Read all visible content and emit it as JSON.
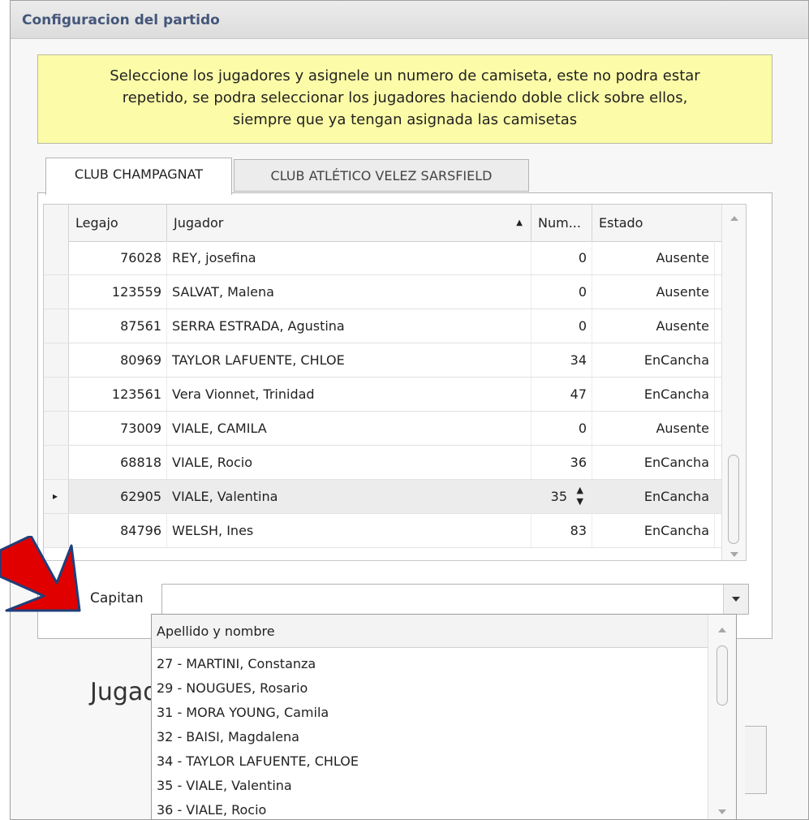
{
  "window": {
    "title": "Configuracion del partido"
  },
  "info": {
    "line1": "Seleccione los jugadores y asignele un numero de camiseta, este no podra estar",
    "line2": "repetido, se podra seleccionar los jugadores haciendo doble click sobre ellos,",
    "line3": "siempre que ya tengan asignada las camisetas"
  },
  "tabs": [
    {
      "label": "CLUB CHAMPAGNAT",
      "active": true
    },
    {
      "label": "CLUB ATLÉTICO VELEZ SARSFIELD",
      "active": false
    }
  ],
  "grid": {
    "headers": {
      "legajo": "Legajo",
      "jugador": "Jugador",
      "num": "Num...",
      "estado": "Estado"
    },
    "sort_indicator": "sort-ascending-icon",
    "rows": [
      {
        "legajo": "76028",
        "jugador": "REY, josefina",
        "num": "0",
        "estado": "Ausente"
      },
      {
        "legajo": "123559",
        "jugador": "SALVAT, Malena",
        "num": "0",
        "estado": "Ausente"
      },
      {
        "legajo": "87561",
        "jugador": "SERRA ESTRADA, Agustina",
        "num": "0",
        "estado": "Ausente"
      },
      {
        "legajo": "80969",
        "jugador": "TAYLOR LAFUENTE, CHLOE",
        "num": "34",
        "estado": "EnCancha"
      },
      {
        "legajo": "123561",
        "jugador": "Vera Vionnet, Trinidad",
        "num": "47",
        "estado": "EnCancha"
      },
      {
        "legajo": "73009",
        "jugador": "VIALE, CAMILA",
        "num": "0",
        "estado": "Ausente"
      },
      {
        "legajo": "68818",
        "jugador": "VIALE, Rocio",
        "num": "36",
        "estado": "EnCancha"
      },
      {
        "legajo": "62905",
        "jugador": "VIALE, Valentina",
        "num": "35",
        "estado": "EnCancha",
        "selected": true
      },
      {
        "legajo": "84796",
        "jugador": "WELSH, Ines",
        "num": "83",
        "estado": "EnCancha"
      }
    ]
  },
  "capitan": {
    "label": "Capitan",
    "value": "",
    "dropdown_header": "Apellido y nombre",
    "options": [
      "27 - MARTINI, Constanza",
      "29 - NOUGUES, Rosario",
      "31 - MORA YOUNG, Camila",
      "32 - BAISI, Magdalena",
      "34 - TAYLOR LAFUENTE, CHLOE",
      "35 - VIALE, Valentina",
      "36 - VIALE, Rocio"
    ]
  },
  "background_label": "Jugad",
  "colors": {
    "title_text": "#44577a",
    "info_bg": "#fcfca8",
    "annotation_arrow": "#e00000"
  }
}
